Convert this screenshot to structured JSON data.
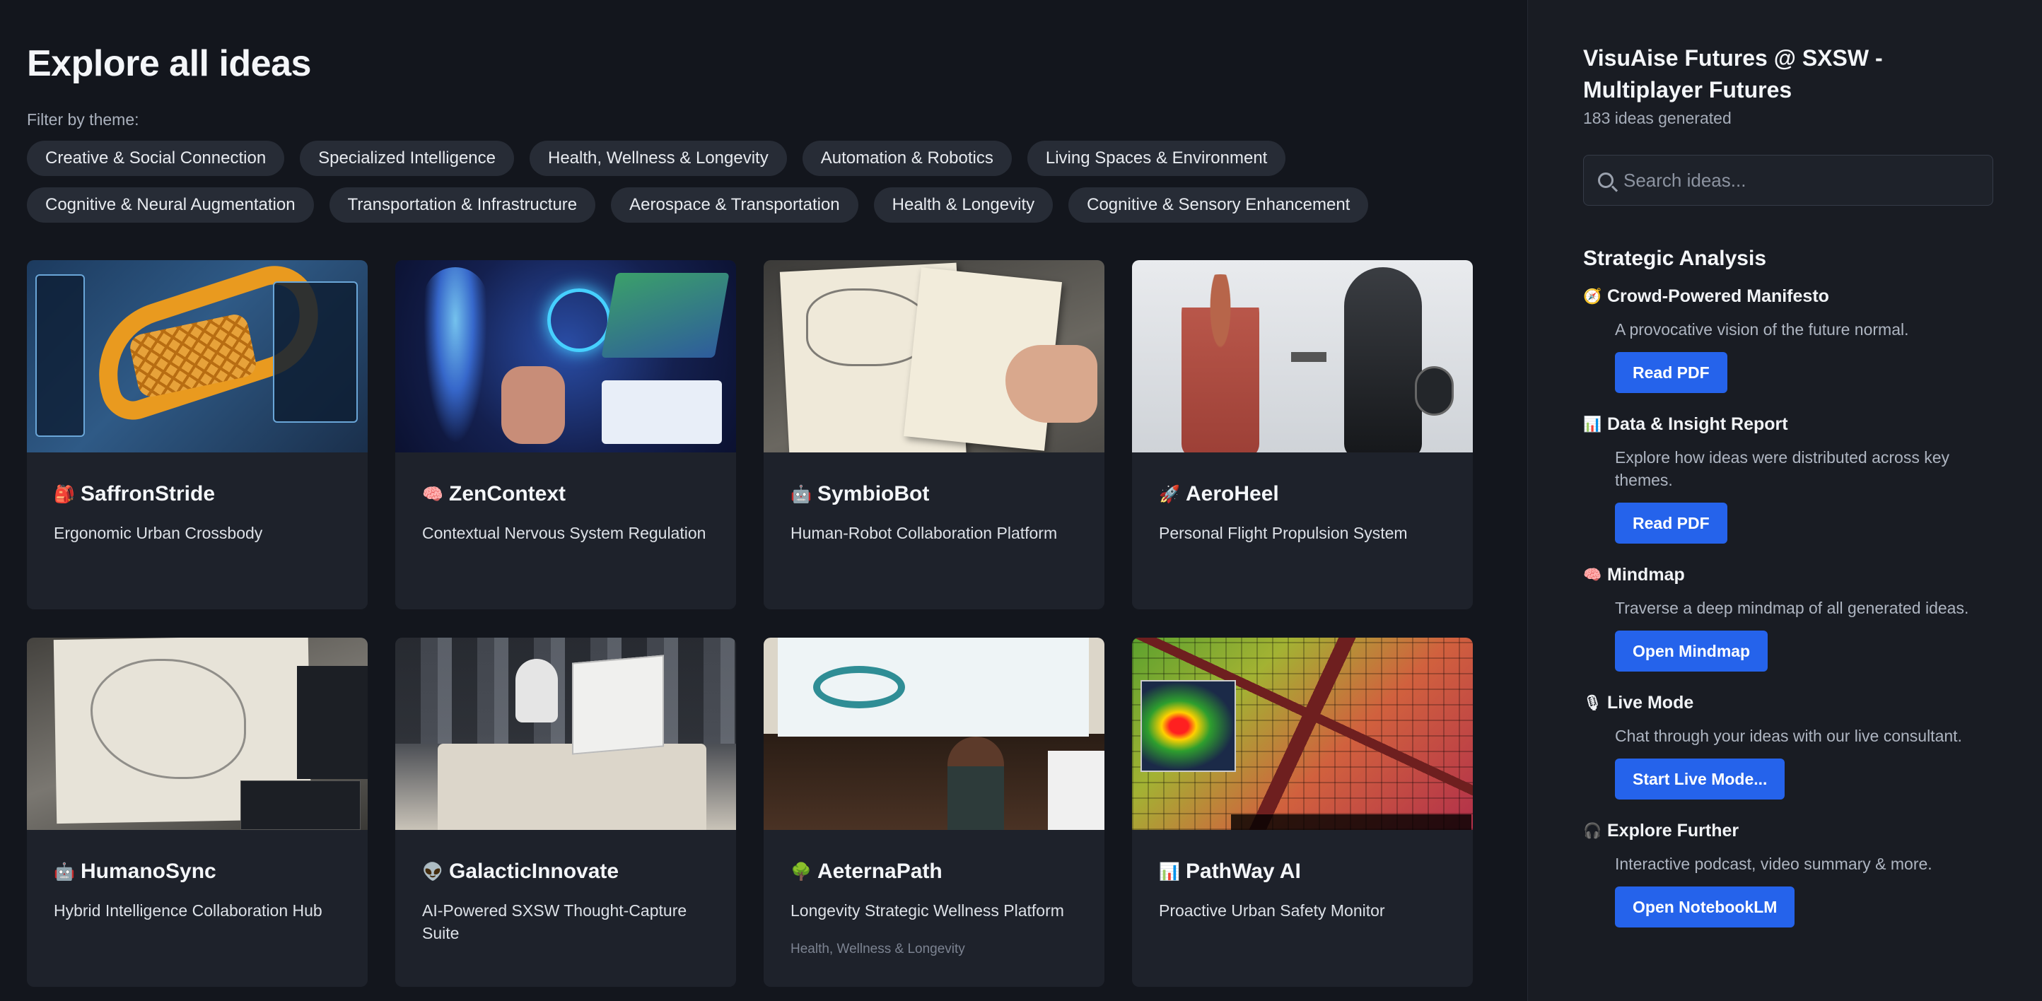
{
  "main": {
    "title": "Explore all ideas",
    "filter_label": "Filter by theme:",
    "themes": [
      "Creative & Social Connection",
      "Specialized Intelligence",
      "Health, Wellness & Longevity",
      "Automation & Robotics",
      "Living Spaces & Environment",
      "Cognitive & Neural Augmentation",
      "Transportation & Infrastructure",
      "Aerospace & Transportation",
      "Health & Longevity",
      "Cognitive & Sensory Enhancement"
    ],
    "cards": [
      {
        "icon": "🎒",
        "icon_name": "backpack-icon",
        "title": "SaffronStride",
        "desc": "Ergonomic Urban Crossbody",
        "tag": ""
      },
      {
        "icon": "🧠",
        "icon_name": "brain-icon",
        "title": "ZenContext",
        "desc": "Contextual Nervous System Regulation",
        "tag": ""
      },
      {
        "icon": "🤖",
        "icon_name": "robot-icon",
        "title": "SymbioBot",
        "desc": "Human-Robot Collaboration Platform",
        "tag": ""
      },
      {
        "icon": "🚀",
        "icon_name": "rocket-icon",
        "title": "AeroHeel",
        "desc": "Personal Flight Propulsion System",
        "tag": ""
      },
      {
        "icon": "🤖",
        "icon_name": "robot-icon",
        "title": "HumanoSync",
        "desc": "Hybrid Intelligence Collaboration Hub",
        "tag": ""
      },
      {
        "icon": "👽",
        "icon_name": "alien-icon",
        "title": "GalacticInnovate",
        "desc": "AI-Powered SXSW Thought-Capture Suite",
        "tag": ""
      },
      {
        "icon": "🌳",
        "icon_name": "tree-icon",
        "title": "AeternaPath",
        "desc": "Longevity Strategic Wellness Platform",
        "tag": "Health, Wellness & Longevity"
      },
      {
        "icon": "📊",
        "icon_name": "bar-chart-icon",
        "title": "PathWay AI",
        "desc": "Proactive Urban Safety Monitor",
        "tag": ""
      }
    ]
  },
  "sidebar": {
    "title": "VisuAise Futures @ SXSW - Multiplayer Futures",
    "count": "183 ideas generated",
    "search_placeholder": "Search ideas...",
    "analysis_heading": "Strategic Analysis",
    "items": [
      {
        "icon": "🧭",
        "icon_name": "compass-icon",
        "title": "Crowd-Powered Manifesto",
        "desc": "A provocative vision of the future normal.",
        "button": "Read PDF"
      },
      {
        "icon": "📊",
        "icon_name": "bar-chart-icon",
        "title": "Data & Insight Report",
        "desc": "Explore how ideas were distributed across key themes.",
        "button": "Read PDF"
      },
      {
        "icon": "🧠",
        "icon_name": "brain-icon",
        "title": "Mindmap",
        "desc": "Traverse a deep mindmap of all generated ideas.",
        "button": "Open Mindmap"
      },
      {
        "icon": "🎙",
        "icon_name": "microphone-icon",
        "title": "Live Mode",
        "desc": "Chat through your ideas with our live consultant.",
        "button": "Start Live Mode..."
      },
      {
        "icon": "🎧",
        "icon_name": "headphones-icon",
        "title": "Explore Further",
        "desc": "Interactive podcast, video summary & more.",
        "button": "Open NotebookLM"
      }
    ]
  },
  "colors": {
    "background": "#13161d",
    "card": "#1e222b",
    "sidebar": "#191c23",
    "chip": "#272c36",
    "accent_button": "#2563eb"
  }
}
